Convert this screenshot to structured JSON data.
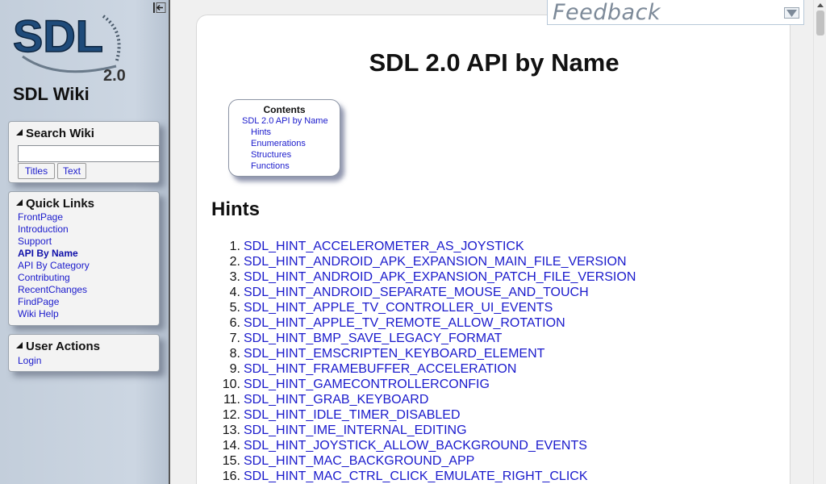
{
  "sidebar": {
    "wiki_title": "SDL Wiki",
    "logo_text": "SDL",
    "logo_version": "2.0",
    "search": {
      "title": "Search Wiki",
      "input_value": "",
      "titles_button": "Titles",
      "text_button": "Text"
    },
    "quick_links": {
      "title": "Quick Links",
      "items": [
        {
          "label": "FrontPage",
          "active": false
        },
        {
          "label": "Introduction",
          "active": false
        },
        {
          "label": "Support",
          "active": false
        },
        {
          "label": "API By Name",
          "active": true
        },
        {
          "label": "API By Category",
          "active": false
        },
        {
          "label": "Contributing",
          "active": false
        },
        {
          "label": "RecentChanges",
          "active": false
        },
        {
          "label": "FindPage",
          "active": false
        },
        {
          "label": "Wiki Help",
          "active": false
        }
      ]
    },
    "user_actions": {
      "title": "User Actions",
      "items": [
        "Login"
      ]
    }
  },
  "feedback": {
    "label": "Feedback"
  },
  "content": {
    "page_title": "SDL 2.0 API by Name",
    "toc": {
      "title": "Contents",
      "items": [
        {
          "label": "SDL 2.0 API by Name",
          "level": 1
        },
        {
          "label": "Hints",
          "level": 2
        },
        {
          "label": "Enumerations",
          "level": 2
        },
        {
          "label": "Structures",
          "level": 2
        },
        {
          "label": "Functions",
          "level": 2
        }
      ]
    },
    "hints_heading": "Hints",
    "hints": [
      "SDL_HINT_ACCELEROMETER_AS_JOYSTICK",
      "SDL_HINT_ANDROID_APK_EXPANSION_MAIN_FILE_VERSION",
      "SDL_HINT_ANDROID_APK_EXPANSION_PATCH_FILE_VERSION",
      "SDL_HINT_ANDROID_SEPARATE_MOUSE_AND_TOUCH",
      "SDL_HINT_APPLE_TV_CONTROLLER_UI_EVENTS",
      "SDL_HINT_APPLE_TV_REMOTE_ALLOW_ROTATION",
      "SDL_HINT_BMP_SAVE_LEGACY_FORMAT",
      "SDL_HINT_EMSCRIPTEN_KEYBOARD_ELEMENT",
      "SDL_HINT_FRAMEBUFFER_ACCELERATION",
      "SDL_HINT_GAMECONTROLLERCONFIG",
      "SDL_HINT_GRAB_KEYBOARD",
      "SDL_HINT_IDLE_TIMER_DISABLED",
      "SDL_HINT_IME_INTERNAL_EDITING",
      "SDL_HINT_JOYSTICK_ALLOW_BACKGROUND_EVENTS",
      "SDL_HINT_MAC_BACKGROUND_APP",
      "SDL_HINT_MAC_CTRL_CLICK_EMULATE_RIGHT_CLICK"
    ]
  },
  "colors": {
    "link": "#1a1acc",
    "sidebar_bg": "#c3cedb",
    "feedback_text": "#7d8a99"
  }
}
